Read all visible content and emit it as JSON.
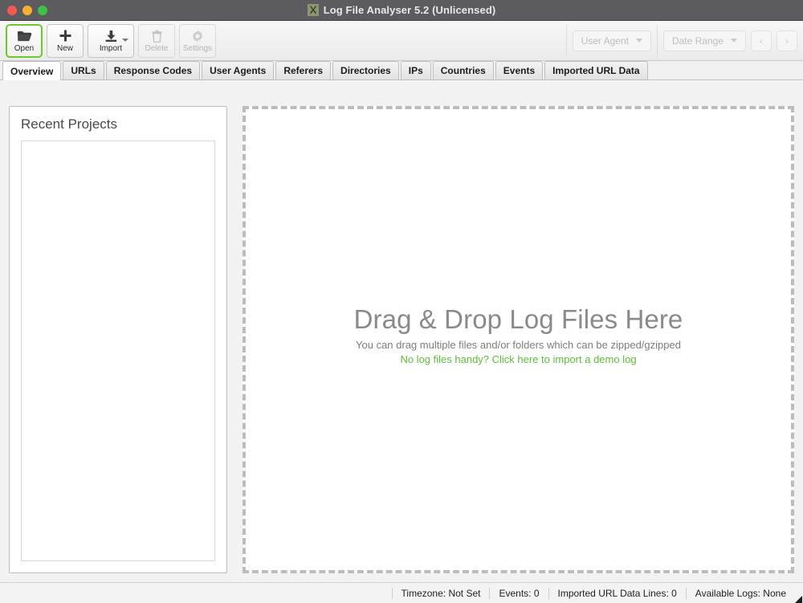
{
  "titlebar": {
    "app_title": "Log File Analyser 5.2 (Unlicensed)",
    "app_icon": "log-file-analyser-icon",
    "buttons": [
      {
        "name": "close",
        "color": "#f4584f"
      },
      {
        "name": "minimize",
        "color": "#f9b12f"
      },
      {
        "name": "maximize",
        "color": "#3ec145"
      }
    ]
  },
  "toolbar": {
    "buttons": [
      {
        "label": "Open",
        "icon": "folder-open-icon",
        "disabled": false,
        "focused": true,
        "has_dropdown": false
      },
      {
        "label": "New",
        "icon": "plus-icon",
        "disabled": false,
        "focused": false,
        "has_dropdown": false
      },
      {
        "label": "Import",
        "icon": "download-icon",
        "disabled": false,
        "focused": false,
        "has_dropdown": true
      },
      {
        "label": "Delete",
        "icon": "trash-icon",
        "disabled": true,
        "focused": false,
        "has_dropdown": false
      },
      {
        "label": "Settings",
        "icon": "gear-icon",
        "disabled": true,
        "focused": false,
        "has_dropdown": false
      }
    ],
    "user_agent_filter": "User Agent",
    "date_range_filter": "Date Range",
    "prev_arrow": "‹",
    "next_arrow": "›",
    "focus_color": "#6fc72b"
  },
  "tabs": [
    {
      "label": "Overview",
      "active": true
    },
    {
      "label": "URLs",
      "active": false
    },
    {
      "label": "Response Codes",
      "active": false
    },
    {
      "label": "User Agents",
      "active": false
    },
    {
      "label": "Referers",
      "active": false
    },
    {
      "label": "Directories",
      "active": false
    },
    {
      "label": "IPs",
      "active": false
    },
    {
      "label": "Countries",
      "active": false
    },
    {
      "label": "Events",
      "active": false
    },
    {
      "label": "Imported URL Data",
      "active": false
    }
  ],
  "recent_projects": {
    "title": "Recent Projects",
    "items": []
  },
  "dropzone": {
    "title": "Drag & Drop Log Files Here",
    "subtitle": "You can drag multiple files and/or folders which can be zipped/gzipped",
    "link": "No log files handy? Click here to import a demo log",
    "link_color": "#5cbd3a"
  },
  "statusbar": {
    "items": [
      "Timezone:  Not Set",
      "Events: 0",
      "Imported URL Data Lines: 0",
      "Available Logs: None"
    ],
    "resize_grip": "resize-grip-icon"
  }
}
